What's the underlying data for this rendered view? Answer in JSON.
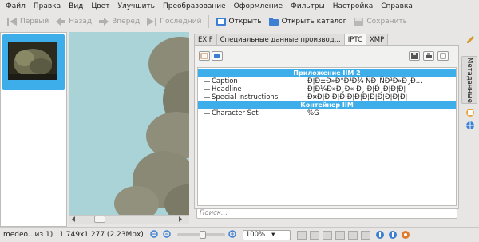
{
  "menu": [
    {
      "label": "Файл"
    },
    {
      "label": "Правка"
    },
    {
      "label": "Вид"
    },
    {
      "label": "Цвет"
    },
    {
      "label": "Улучшить"
    },
    {
      "label": "Преобразование"
    },
    {
      "label": "Оформление"
    },
    {
      "label": "Фильтры"
    },
    {
      "label": "Настройка"
    },
    {
      "label": "Справка"
    }
  ],
  "toolbar": {
    "first": "Первый",
    "back": "Назад",
    "forward": "Вперёд",
    "last": "Последний",
    "open": "Открыть",
    "open_catalog": "Открыть каталог",
    "save": "Сохранить"
  },
  "tabs": [
    {
      "label": "EXIF"
    },
    {
      "label": "Специальные данные производ..."
    },
    {
      "label": "IPTC",
      "active": true
    },
    {
      "label": "XMP"
    }
  ],
  "metadata": {
    "group1": "Приложение IIM 2",
    "rows1": [
      {
        "key": "Caption",
        "value": "Ð¦Ð±Ð»Ð°Ð³Ð¾ ÑÐ¸ÑÐ³Ð»Ð¸Ð..."
      },
      {
        "key": "Headline",
        "value": "Ð¦Ð¼Ð»Ð¸Ð« Ð¸ Ð¦Ð¸Ð¦Ð¦Ð¦"
      },
      {
        "key": "Special Instructions",
        "value": "Ð¤Ð¦Ð¦Ð¦Ð¦Ð¦Ð¦Ð¦Ð¦Ð¦Ð¦Ð¦Ð¦"
      }
    ],
    "group2": "Контейнер IIM",
    "rows2": [
      {
        "key": "Character Set",
        "value": "%G"
      }
    ]
  },
  "search": {
    "placeholder": "Поиск..."
  },
  "side_label": "Метаданные",
  "status": {
    "filename": "medeo...из 1)",
    "dimensions": "1 749x1 277 (2.23Mpx)",
    "zoom": "100%"
  },
  "colors": {
    "accent": "#3daee9",
    "viewer_bg": "#a9d3d6"
  }
}
